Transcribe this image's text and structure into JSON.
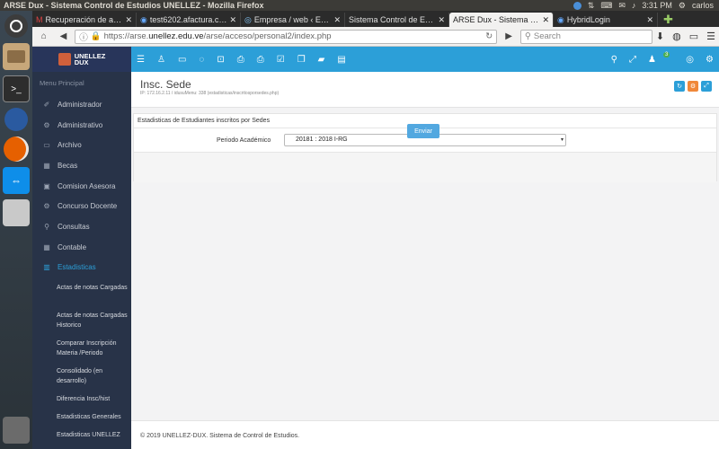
{
  "os": {
    "window_title": "ARSE Dux - Sistema Control de Estudios UNELLEZ - Mozilla Firefox",
    "time": "3:31 PM",
    "user": "carlos"
  },
  "browser": {
    "tabs": [
      {
        "label": "Recuperación de ac…",
        "active": false
      },
      {
        "label": "test6202.afactura.c…",
        "active": false
      },
      {
        "label": "Empresa / web ‹ E-7…",
        "active": false
      },
      {
        "label": "Sistema Control de Est…",
        "active": false
      },
      {
        "label": "ARSE Dux - Sistema Co…",
        "active": true
      },
      {
        "label": "HybridLogin",
        "active": false
      }
    ],
    "url_prefix": "https://arse.",
    "url_host": "unellez.edu.ve",
    "url_path": "/arse/acceso/personal2/index.php",
    "search_placeholder": "Search"
  },
  "app": {
    "logo_line1": "UNELLEZ",
    "logo_line2": "DUX"
  },
  "sidebar": {
    "title": "Menu Principal",
    "items": [
      {
        "label": "Administrador",
        "icon": "✐"
      },
      {
        "label": "Administrativo",
        "icon": "⚙"
      },
      {
        "label": "Archivo",
        "icon": "▭"
      },
      {
        "label": "Becas",
        "icon": "▦"
      },
      {
        "label": "Comision Asesora",
        "icon": "▣"
      },
      {
        "label": "Concurso Docente",
        "icon": "⚙"
      },
      {
        "label": "Consultas",
        "icon": "⚲"
      },
      {
        "label": "Contable",
        "icon": "▦"
      },
      {
        "label": "Estadisticas",
        "icon": "▥"
      }
    ],
    "subitems": [
      "Actas de notas Cargadas",
      "Actas de notas Cargadas Historico",
      "Comparar Inscripción Materia /Periodo",
      "Consolidado (en desarrollo)",
      "Diferencia Insc/hist",
      "Estadisticas Generales",
      "Estadisticas UNELLEZ"
    ]
  },
  "page": {
    "title": "Insc. Sede",
    "subtitle": "IP: 172.16.2.11 / idusuMenu: 338 (estadisticas/inscritosporsedes.php)",
    "panel_title": "Estadisticas de Estudiantes inscritos por Sedes",
    "field_label": "Periodo Académico",
    "field_value": "20181 : 2018 I-RG",
    "submit_label": "Enviar",
    "footer": "© 2019 UNELLEZ-DUX. Sistema de Control de Estudios."
  },
  "colors": {
    "header": "#2c9fd8",
    "sidebar": "#283348",
    "active_item": "#2c9fd8"
  }
}
